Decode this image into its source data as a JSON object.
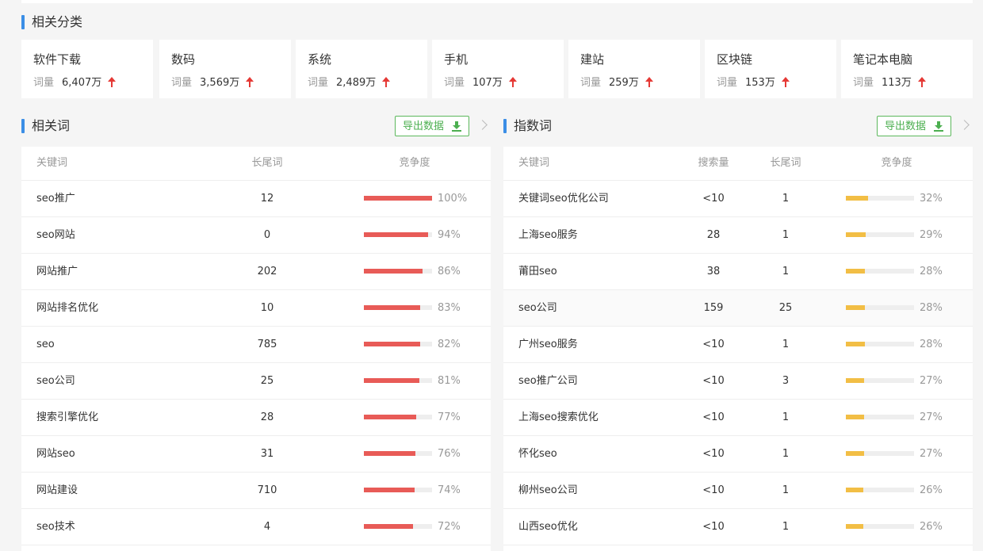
{
  "related_categories": {
    "title": "相关分类",
    "vol_label": "词量",
    "items": [
      {
        "name": "软件下载",
        "volume": "6,407万"
      },
      {
        "name": "数码",
        "volume": "3,569万"
      },
      {
        "name": "系统",
        "volume": "2,489万"
      },
      {
        "name": "手机",
        "volume": "107万"
      },
      {
        "name": "建站",
        "volume": "259万"
      },
      {
        "name": "区块链",
        "volume": "153万"
      },
      {
        "name": "笔记本电脑",
        "volume": "113万"
      }
    ]
  },
  "related_words": {
    "title": "相关词",
    "export_label": "导出数据",
    "columns": [
      "关键词",
      "长尾词",
      "竞争度"
    ],
    "bar_color": "#e85b57",
    "rows": [
      {
        "keyword": "seo推广",
        "longtail": "12",
        "competition": 100,
        "competition_text": "100%"
      },
      {
        "keyword": "seo网站",
        "longtail": "0",
        "competition": 94,
        "competition_text": "94%"
      },
      {
        "keyword": "网站推广",
        "longtail": "202",
        "competition": 86,
        "competition_text": "86%"
      },
      {
        "keyword": "网站排名优化",
        "longtail": "10",
        "competition": 83,
        "competition_text": "83%"
      },
      {
        "keyword": "seo",
        "longtail": "785",
        "competition": 82,
        "competition_text": "82%"
      },
      {
        "keyword": "seo公司",
        "longtail": "25",
        "competition": 81,
        "competition_text": "81%"
      },
      {
        "keyword": "搜索引擎优化",
        "longtail": "28",
        "competition": 77,
        "competition_text": "77%"
      },
      {
        "keyword": "网站seo",
        "longtail": "31",
        "competition": 76,
        "competition_text": "76%"
      },
      {
        "keyword": "网站建设",
        "longtail": "710",
        "competition": 74,
        "competition_text": "74%"
      },
      {
        "keyword": "seo技术",
        "longtail": "4",
        "competition": 72,
        "competition_text": "72%"
      }
    ]
  },
  "index_words": {
    "title": "指数词",
    "export_label": "导出数据",
    "columns": [
      "关键词",
      "搜索量",
      "长尾词",
      "竞争度"
    ],
    "bar_color": "#f2be45",
    "rows": [
      {
        "keyword": "关键词seo优化公司",
        "search": "<10",
        "longtail": "1",
        "competition": 32,
        "competition_text": "32%"
      },
      {
        "keyword": "上海seo服务",
        "search": "28",
        "longtail": "1",
        "competition": 29,
        "competition_text": "29%"
      },
      {
        "keyword": "莆田seo",
        "search": "38",
        "longtail": "1",
        "competition": 28,
        "competition_text": "28%"
      },
      {
        "keyword": "seo公司",
        "search": "159",
        "longtail": "25",
        "competition": 28,
        "competition_text": "28%",
        "highlighted": true
      },
      {
        "keyword": "广州seo服务",
        "search": "<10",
        "longtail": "1",
        "competition": 28,
        "competition_text": "28%"
      },
      {
        "keyword": "seo推广公司",
        "search": "<10",
        "longtail": "3",
        "competition": 27,
        "competition_text": "27%"
      },
      {
        "keyword": "上海seo搜索优化",
        "search": "<10",
        "longtail": "1",
        "competition": 27,
        "competition_text": "27%"
      },
      {
        "keyword": "怀化seo",
        "search": "<10",
        "longtail": "1",
        "competition": 27,
        "competition_text": "27%"
      },
      {
        "keyword": "柳州seo公司",
        "search": "<10",
        "longtail": "1",
        "competition": 26,
        "competition_text": "26%"
      },
      {
        "keyword": "山西seo优化",
        "search": "<10",
        "longtail": "1",
        "competition": 26,
        "competition_text": "26%"
      }
    ]
  }
}
